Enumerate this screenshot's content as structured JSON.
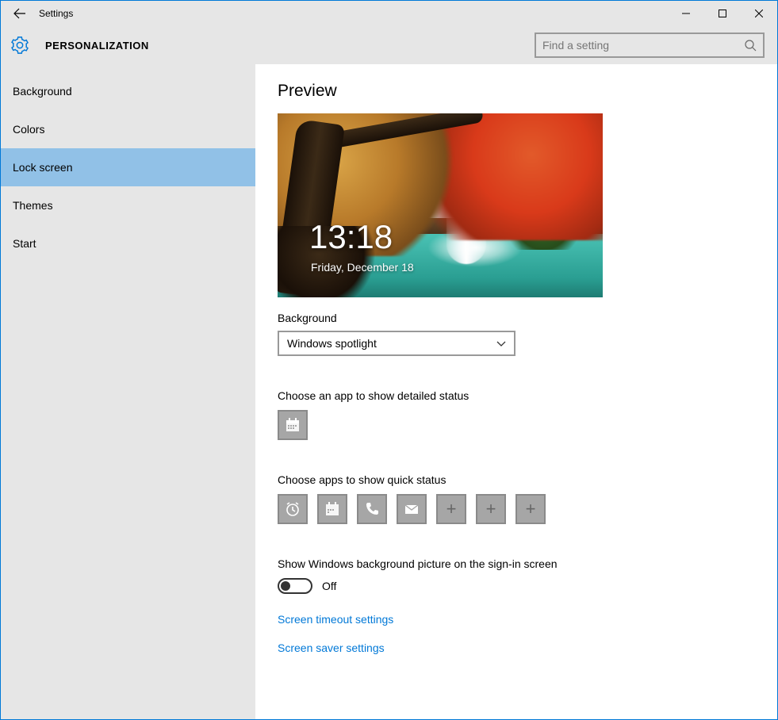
{
  "window": {
    "title": "Settings"
  },
  "header": {
    "section": "PERSONALIZATION",
    "search_placeholder": "Find a setting"
  },
  "sidebar": {
    "items": [
      {
        "label": "Background"
      },
      {
        "label": "Colors"
      },
      {
        "label": "Lock screen"
      },
      {
        "label": "Themes"
      },
      {
        "label": "Start"
      }
    ],
    "selected_index": 2
  },
  "main": {
    "preview_heading": "Preview",
    "clock": "13:18",
    "date": "Friday, December 18",
    "background_label": "Background",
    "background_value": "Windows spotlight",
    "detailed_status_label": "Choose an app to show detailed status",
    "detailed_status_app": "calendar-icon",
    "quick_status_label": "Choose apps to show quick status",
    "quick_status_apps": [
      "alarm-icon",
      "calendar-icon",
      "phone-icon",
      "mail-icon",
      "plus-icon",
      "plus-icon",
      "plus-icon"
    ],
    "signin_toggle_label": "Show Windows background picture on the sign-in screen",
    "signin_toggle_state": "Off",
    "link_timeout": "Screen timeout settings",
    "link_saver": "Screen saver settings"
  }
}
